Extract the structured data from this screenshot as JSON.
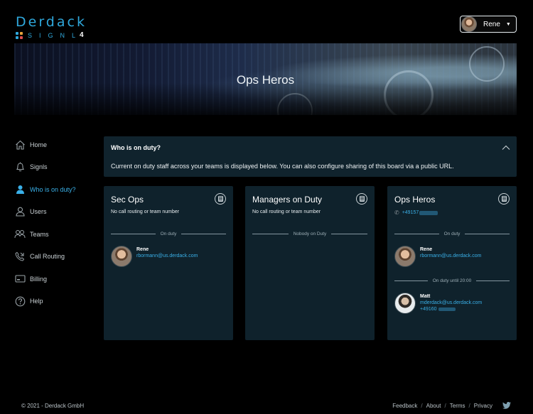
{
  "brand": {
    "wordmark": "Derdack",
    "product": "SIGNL",
    "product_version": "4",
    "dot_colors": [
      "#2fa8dc",
      "#e8a33a",
      "#2fa8dc",
      "#e04e4e"
    ]
  },
  "user_menu": {
    "name": "Rene",
    "caret": "▼"
  },
  "banner": {
    "title": "Ops Heros"
  },
  "sidebar": {
    "items": [
      {
        "label": "Home",
        "icon": "home-icon",
        "glyph": "⌂",
        "active": false
      },
      {
        "label": "Signls",
        "icon": "bell-icon",
        "glyph": "🔔︎",
        "active": false
      },
      {
        "label": "Who is on duty?",
        "icon": "person-duty-icon",
        "glyph": "●",
        "active": true
      },
      {
        "label": "Users",
        "icon": "user-icon",
        "glyph": "♙",
        "active": false
      },
      {
        "label": "Teams",
        "icon": "teams-icon",
        "glyph": "⚇",
        "active": false
      },
      {
        "label": "Call Routing",
        "icon": "phone-routing-icon",
        "glyph": "✆",
        "active": false
      },
      {
        "label": "Billing",
        "icon": "billing-icon",
        "glyph": "▭",
        "active": false
      },
      {
        "label": "Help",
        "icon": "help-icon",
        "glyph": "?",
        "active": false
      }
    ]
  },
  "info_panel": {
    "title": "Who is on duty?",
    "text": "Current on duty staff across your teams is displayed below. You can also configure sharing of this board via a public URL.",
    "toggle_icon": "chevron-up-icon"
  },
  "cards": {
    "sec_ops": {
      "title": "Sec Ops",
      "subtitle": "No call routing or team number",
      "divider": "On duty",
      "person": {
        "name": "Rene",
        "email": "rbormann@us.derdack.com"
      }
    },
    "managers": {
      "title": "Managers on Duty",
      "subtitle": "No call routing or team number",
      "divider": "Nobody on Duty"
    },
    "ops_heros": {
      "title": "Ops Heros",
      "phone": "+49157",
      "divider": "On duty",
      "person1": {
        "name": "Rene",
        "email": "rbormann@us.derdack.com"
      },
      "divider2": "On duty until 20:00",
      "person2": {
        "name": "Matt",
        "email": "mderdack@us.derdack.com",
        "phone": "+49160"
      }
    }
  },
  "footer": {
    "copyright": "© 2021 - Derdack GmbH",
    "links": [
      "Feedback",
      "About",
      "Terms",
      "Privacy"
    ],
    "social_icon": "twitter-icon"
  }
}
